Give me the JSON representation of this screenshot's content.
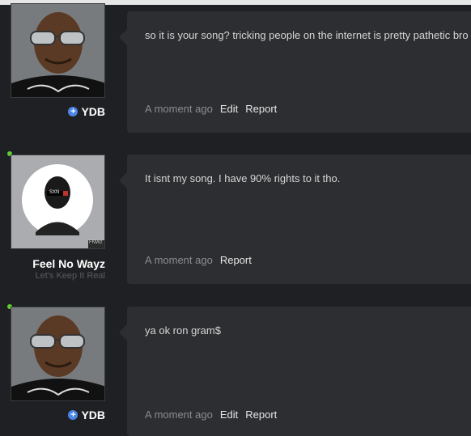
{
  "comments": [
    {
      "user": "YDB",
      "subtitle": "",
      "has_plus_badge": true,
      "online": false,
      "avatar_desc": "ydb-avatar",
      "message": "so it is your song? tricking people on the internet is pretty pathetic bro",
      "time": "A moment ago",
      "actions": [
        "Edit",
        "Report"
      ]
    },
    {
      "user": "Feel No Wayz",
      "subtitle": "Let's Keep It Real",
      "has_plus_badge": false,
      "online": true,
      "avatar_desc": "feel-no-wayz-avatar",
      "avatar_badge_text": "SXN",
      "avatar_corner_text": "FNWz",
      "message": "It isnt my song. I have 90% rights to it tho.",
      "time": "A moment ago",
      "actions": [
        "Report"
      ]
    },
    {
      "user": "YDB",
      "subtitle": "",
      "has_plus_badge": true,
      "online": true,
      "avatar_desc": "ydb-avatar",
      "message": "ya ok ron gram$",
      "time": "A moment ago",
      "actions": [
        "Edit",
        "Report"
      ]
    }
  ],
  "colors": {
    "background": "#1f2023",
    "bubble": "#2d2e31",
    "plus_badge": "#4a86e8",
    "online_dot": "#5fcf2f"
  }
}
